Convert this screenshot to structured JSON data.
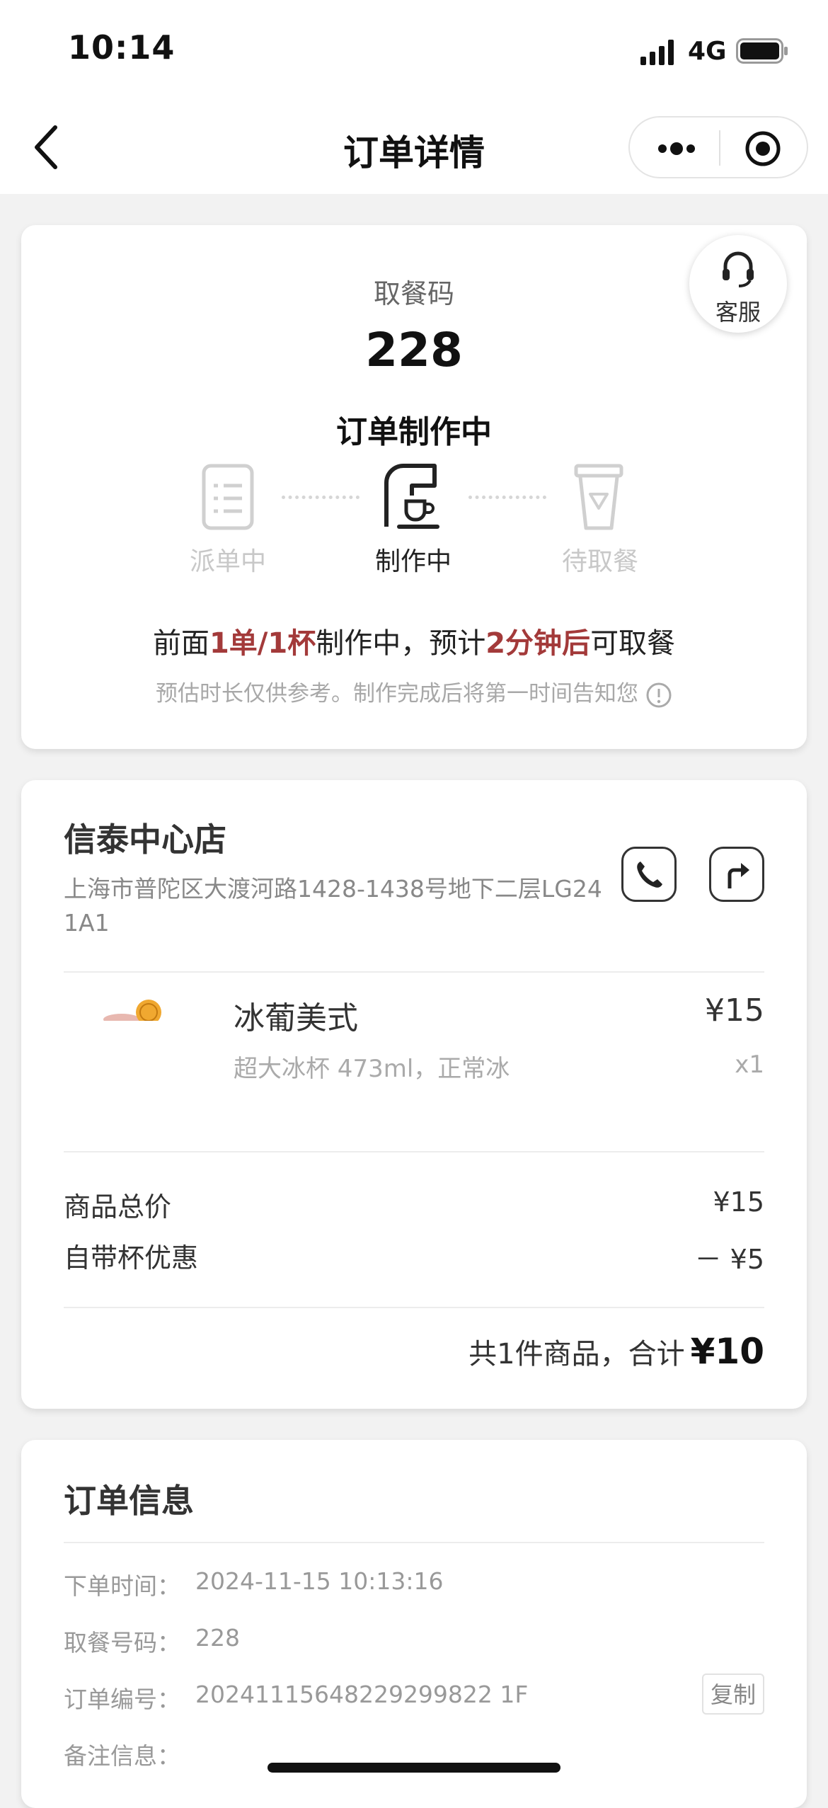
{
  "status_bar": {
    "time": "10:14",
    "network": "4G"
  },
  "nav": {
    "title": "订单详情"
  },
  "status_card": {
    "customer_service_label": "客服",
    "pickup_label": "取餐码",
    "pickup_code": "228",
    "status_title": "订单制作中",
    "steps": [
      {
        "label": "派单中",
        "icon": "clipboard-list-icon",
        "active": false
      },
      {
        "label": "制作中",
        "icon": "coffee-machine-icon",
        "active": true
      },
      {
        "label": "待取餐",
        "icon": "cup-icon",
        "active": false
      }
    ],
    "queue": {
      "prefix": "前面",
      "count": "1单/1杯",
      "middle": "制作中，预计",
      "eta": "2分钟后",
      "suffix": "可取餐"
    },
    "estimate_note": "预估时长仅供参考。制作完成后将第一时间告知您",
    "highlight_color": "#a33a3a"
  },
  "store": {
    "name": "信泰中心店",
    "address": "上海市普陀区大渡河路1428-1438号地下二层LG241A1",
    "item": {
      "name": "冰葡美式",
      "spec": "超大冰杯 473ml，正常冰",
      "price": "¥15",
      "qty": "x1"
    },
    "subtotal_label": "商品总价",
    "subtotal_value": "¥15",
    "discount_label": "自带杯优惠",
    "discount_value": "－ ¥5",
    "total_prefix": "共1件商品，合计",
    "total_amount": "¥10"
  },
  "order_info": {
    "title": "订单信息",
    "rows": [
      {
        "label": "下单时间：",
        "value": "2024-11-15 10:13:16"
      },
      {
        "label": "取餐号码：",
        "value": "228"
      },
      {
        "label": "订单编号：",
        "value": "20241115648229299822 1F"
      },
      {
        "label": "备注信息：",
        "value": ""
      }
    ],
    "copy_label": "复制"
  }
}
